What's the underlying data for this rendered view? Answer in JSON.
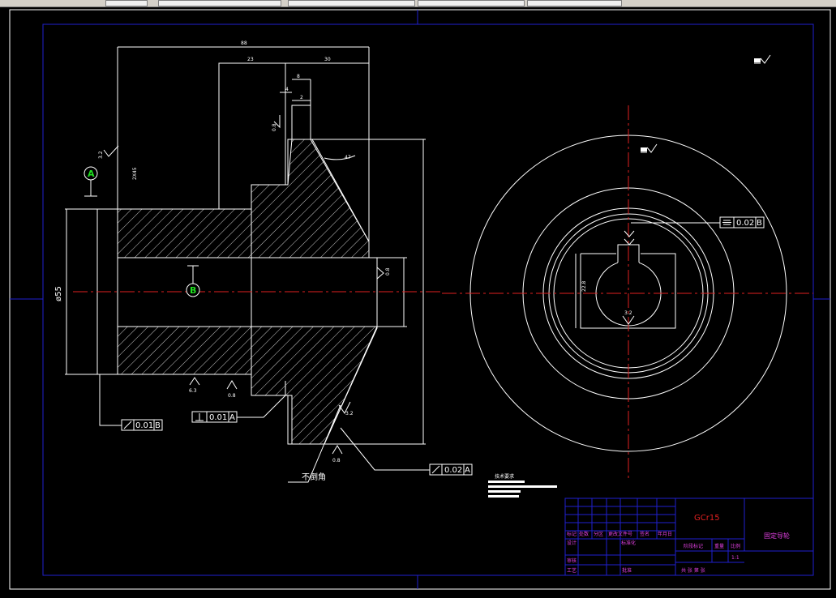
{
  "drawing": {
    "material": "GCr15",
    "part_name": "固定导轮",
    "title_block": {
      "row1": [
        "标记",
        "处数",
        "分区",
        "更改文件号",
        "签名",
        "年月日"
      ],
      "design": "设计",
      "standardize": "标准化",
      "stage_mark": "阶段标记",
      "weight": "重量",
      "scale": "比例",
      "scale_value": "1:1",
      "review": "审核",
      "process": "工艺",
      "approve": "批准",
      "sheets": "共  张  第  张"
    },
    "tech_req_title": "技术要求",
    "datum_a": "A",
    "datum_b": "B",
    "diameter_label": "ø55",
    "no_chamfer": "不倒角",
    "chamfer": "2X45",
    "fcf": {
      "runout_b": "0.01",
      "runout_b_ref": "B",
      "perp_a": "0.01",
      "perp_a_ref": "A",
      "runout_a": "0.02",
      "runout_a_ref": "A",
      "sym_b": "0.02",
      "sym_b_ref": "B"
    },
    "dims": {
      "overall_len": "88",
      "len1": "23",
      "len2": "30",
      "len3": "8",
      "len4": "4",
      "len5": "2",
      "angle": "47",
      "key_w": "22.8",
      "rough_1": "0.8",
      "rough_2": "3.2",
      "rough_3": "6.3"
    }
  }
}
